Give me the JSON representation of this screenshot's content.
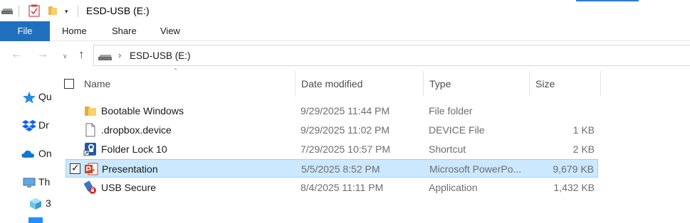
{
  "window": {
    "title": "ESD-USB (E:)"
  },
  "quick_access_toolbar": {
    "icons": [
      "drive-icon",
      "properties-icon",
      "new-folder-icon",
      "customize-dropdown-icon"
    ]
  },
  "ribbon": {
    "tabs": [
      {
        "label": "File",
        "active": true
      },
      {
        "label": "Home"
      },
      {
        "label": "Share"
      },
      {
        "label": "View"
      }
    ],
    "accent_color": "#1f6fbf"
  },
  "address": {
    "location": "ESD-USB (E:)",
    "icons": [
      "back-arrow-icon",
      "forward-arrow-icon",
      "recent-locations-icon",
      "up-arrow-icon",
      "drive-icon",
      "chevron-right-icon"
    ]
  },
  "nav_pane": {
    "items": [
      {
        "label": "Qu",
        "icon": "quick-access-star-icon"
      },
      {
        "label": "Dr",
        "icon": "dropbox-icon"
      },
      {
        "label": "On",
        "icon": "onedrive-cloud-icon"
      },
      {
        "label": "Th",
        "icon": "this-pc-icon"
      },
      {
        "label": "3",
        "icon": "3d-objects-icon"
      }
    ]
  },
  "file_list": {
    "columns": [
      "Name",
      "Date modified",
      "Type",
      "Size"
    ],
    "rows": [
      {
        "name": "Bootable Windows",
        "date": "9/29/2025 11:44 PM",
        "type": "File folder",
        "size": "",
        "icon": "folder-icon",
        "selected": false
      },
      {
        "name": ".dropbox.device",
        "date": "9/29/2025 11:02 PM",
        "type": "DEVICE File",
        "size": "1 KB",
        "icon": "blank-file-icon",
        "selected": false
      },
      {
        "name": "Folder Lock 10",
        "date": "7/29/2025 10:57 PM",
        "type": "Shortcut",
        "size": "2 KB",
        "icon": "folder-lock-shortcut-icon",
        "selected": false
      },
      {
        "name": "Presentation",
        "date": "5/5/2025 8:52 PM",
        "type": "Microsoft PowerPo...",
        "size": "9,679 KB",
        "icon": "powerpoint-icon",
        "selected": true
      },
      {
        "name": "USB Secure",
        "date": "8/4/2025 11:11 PM",
        "type": "Application",
        "size": "1,432 KB",
        "icon": "usb-secure-app-icon",
        "selected": false
      }
    ],
    "selection_color": "#cce8ff"
  }
}
